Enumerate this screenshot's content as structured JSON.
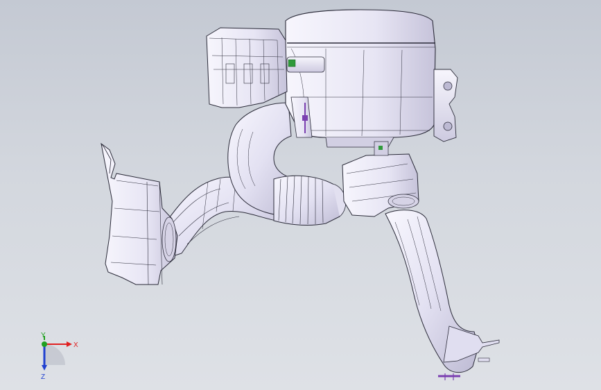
{
  "viewport": {
    "model": "air-intake-assembly",
    "background_top": "#c4c9d3",
    "background_bottom": "#dee1e6"
  },
  "colors": {
    "part_fill": "#eceaf6",
    "part_shade": "#c9c6dc",
    "edge": "#2a2a38",
    "fastener": "#7a3fb0",
    "clip_green": "#2f9a3a"
  },
  "triad": {
    "x_label": "X",
    "y_label": "Y",
    "z_label": "Z",
    "x_color": "#e02020",
    "y_color": "#20a020",
    "z_color": "#2040d0"
  }
}
